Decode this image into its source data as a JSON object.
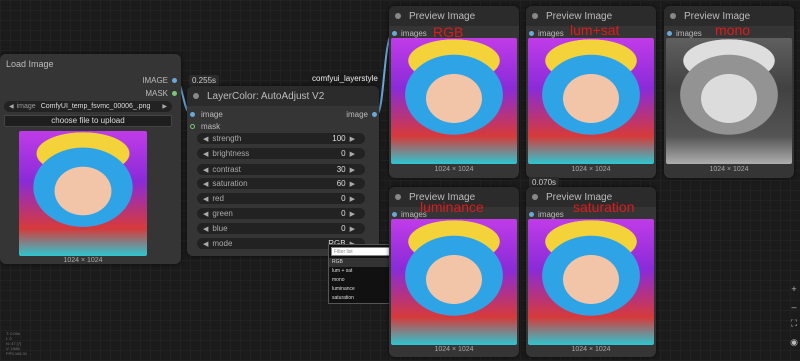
{
  "load_image": {
    "title": "Load Image",
    "output_image": "IMAGE",
    "output_mask": "MASK",
    "image_label": "image",
    "image_value": "ComfyUI_temp_fsvmc_00006_.png",
    "upload_button": "choose file to upload",
    "size": "1024 × 1024"
  },
  "auto_adjust": {
    "timer": "0.255s",
    "group_label": "comfyui_layerstyle",
    "title": "LayerColor: AutoAdjust V2",
    "input_image": "image",
    "input_mask": "mask",
    "output_image": "image",
    "widgets": [
      {
        "label": "strength",
        "value": "100"
      },
      {
        "label": "brightness",
        "value": "0"
      },
      {
        "label": "contrast",
        "value": "30"
      },
      {
        "label": "saturation",
        "value": "60"
      },
      {
        "label": "red",
        "value": "0"
      },
      {
        "label": "green",
        "value": "0"
      },
      {
        "label": "blue",
        "value": "0"
      },
      {
        "label": "mode",
        "value": "RGB"
      }
    ]
  },
  "mode_dropdown": {
    "filter_placeholder": "Filter list",
    "options": [
      "RGB",
      "lum + sat",
      "mono",
      "luminance",
      "saturation"
    ],
    "selected": "RGB"
  },
  "previews": [
    {
      "title": "Preview Image",
      "input": "images",
      "overlay": "RGB",
      "size": "1024 × 1024"
    },
    {
      "title": "Preview Image",
      "input": "images",
      "overlay": "lum+sat",
      "size": "1024 × 1024"
    },
    {
      "title": "Preview Image",
      "input": "images",
      "overlay": "mono",
      "size": "1024 × 1024"
    },
    {
      "title": "Preview Image",
      "input": "images",
      "overlay": "luminance",
      "size": "1024 × 1024"
    },
    {
      "title": "Preview Image",
      "input": "images",
      "overlay": "saturation",
      "size": "1024 × 1024",
      "timer": "0.070s"
    }
  ],
  "stats": [
    "T: 0.00s",
    "I: 0",
    "N: 47 [7]",
    "V: 1588",
    "FPS:166.31"
  ],
  "side_toolbar": {
    "icons": [
      "zoom-in-icon",
      "zoom-out-icon",
      "fit-view-icon",
      "toggle-link-visibility-icon"
    ],
    "glyphs": [
      "+",
      "–",
      "⛶",
      "◉"
    ]
  },
  "colors": {
    "canvas": "#1b1b1b",
    "node_body": "#353535",
    "node_title": "#2b2b2b",
    "link": "#6aa8d8",
    "overlay_text": "#e01a1a"
  }
}
